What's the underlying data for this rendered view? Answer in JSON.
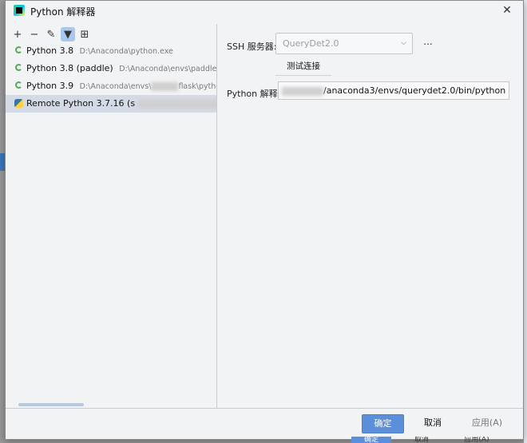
{
  "window": {
    "title": "Python 解释器"
  },
  "toolbar": {
    "add": "+",
    "remove": "−",
    "edit": "✎",
    "filter": "▼",
    "tree": "⊞"
  },
  "interpreters": [
    {
      "name": "Python 3.8",
      "path": "D:\\Anaconda\\python.exe",
      "icon": "python-loading-icon"
    },
    {
      "name": "Python 3.8 (paddle)",
      "path": "D:\\Anaconda\\envs\\paddle\\python.e",
      "icon": "python-loading-icon"
    },
    {
      "name": "Python 3.9",
      "path": "D:\\Anaconda\\envs\\",
      "path_suffix": "\\python.exe",
      "blurred_mid": "flask",
      "icon": "python-loading-icon"
    },
    {
      "name": "Remote Python 3.7.16 (s",
      "path": "",
      "icon": "python-remote-icon",
      "selected": true
    }
  ],
  "ssh": {
    "label": "SSH 服务器:",
    "value": "QueryDet2.0",
    "more": "...",
    "test_label": "测试连接"
  },
  "interpreter_field": {
    "label": "Python 解释器",
    "value": "/anaconda3/envs/querydet2.0/bin/python"
  },
  "buttons": {
    "ok": "确定",
    "cancel": "取消",
    "apply": "应用(A)"
  },
  "background_buttons": {
    "ok": "确定",
    "cancel": "取消",
    "apply": "应用(A)"
  },
  "colors": {
    "primary": "#5b8fd9",
    "selection": "#d5dbe6",
    "filter_active": "#a9c8ec"
  }
}
